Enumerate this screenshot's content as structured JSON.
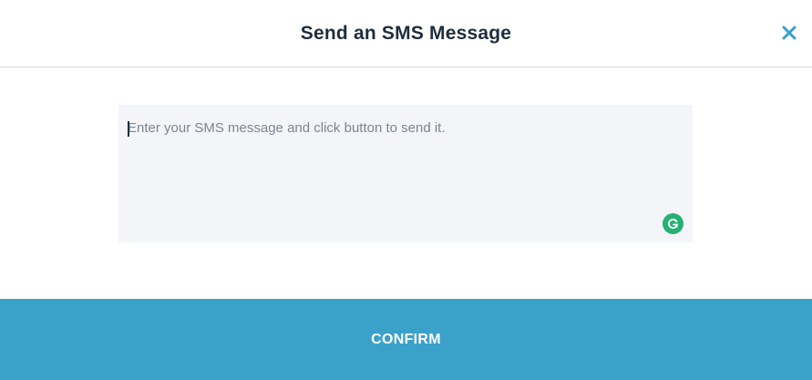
{
  "dialog": {
    "title": "Send an SMS Message",
    "close_icon": "close-icon",
    "message": {
      "placeholder": "Enter your SMS message and click button to send it.",
      "value": ""
    },
    "grammarly_icon": "grammarly-icon",
    "confirm_label": "CONFIRM"
  },
  "colors": {
    "title": "#1f2d3d",
    "close_icon": "#3aa1c9",
    "confirm_background": "#3aa1c9",
    "message_background": "#f3f5f8",
    "grammarly": "#27b073"
  }
}
